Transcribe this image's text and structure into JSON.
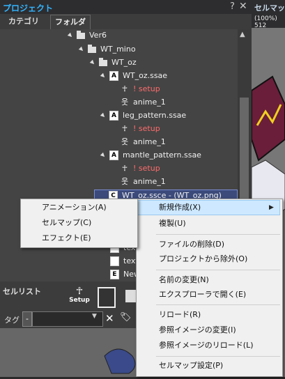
{
  "project_panel": {
    "title": "プロジェクト",
    "help": "?",
    "close": "✕",
    "tabs": [
      "カテゴリ",
      "フォルダ"
    ],
    "tree": [
      {
        "label": "Ver6",
        "type": "folder"
      },
      {
        "label": "WT_mino",
        "type": "folder"
      },
      {
        "label": "WT_oz",
        "type": "folder"
      },
      {
        "label": "WT_oz.ssae",
        "type": "animation"
      },
      {
        "label": "! setup",
        "type": "setup"
      },
      {
        "label": "anime_1",
        "type": "anime"
      },
      {
        "label": "leg_pattern.ssae",
        "type": "animation"
      },
      {
        "label": "! setup",
        "type": "setup"
      },
      {
        "label": "anime_1",
        "type": "anime"
      },
      {
        "label": "mantle_pattern.ssae",
        "type": "animation"
      },
      {
        "label": "! setup",
        "type": "setup"
      },
      {
        "label": "anime_1",
        "type": "anime"
      },
      {
        "label": "WT_oz.ssce - (WT_oz.png)",
        "type": "cellmap"
      },
      {
        "label": "text",
        "type": "doc"
      },
      {
        "label": "text",
        "type": "doc"
      },
      {
        "label": "New",
        "type": "effect"
      }
    ]
  },
  "cellmap_panel": {
    "title": "セルマッ",
    "zoom": "(100%) 512"
  },
  "cell_list": {
    "title": "セルリスト",
    "setup_label": "Setup",
    "tag_label": "タグ",
    "tag_dash": "-",
    "clear": "✕",
    "tag_icon": "🏷"
  },
  "context_menu": {
    "items": [
      "新規作成(X)",
      "複製(U)",
      "ファイルの削除(D)",
      "プロジェクトから除外(O)",
      "名前の変更(N)",
      "エクスプローラで開く(E)",
      "リロード(R)",
      "参照イメージの変更(I)",
      "参照イメージのリロード(L)",
      "セルマップ設定(P)"
    ],
    "submenu_arrow": "▶"
  },
  "submenu": {
    "items": [
      "アニメーション(A)",
      "セルマップ(C)",
      "エフェクト(E)"
    ]
  },
  "colors": {
    "accent": "#33b5ff",
    "setup": "#ff6b6b",
    "selection": "#3b4a7a",
    "menu_highlight": "#cde8ff"
  }
}
